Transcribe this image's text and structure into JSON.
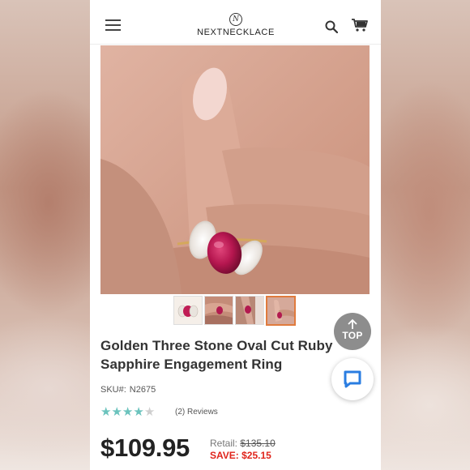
{
  "header": {
    "logo_mark": "N",
    "logo_text": "NEXTNECKLACE",
    "icons": {
      "menu": "hamburger-icon",
      "search": "search-icon",
      "cart": "cart-icon"
    }
  },
  "gallery": {
    "thumbnail_count": 4,
    "active_thumbnail": 4
  },
  "floating": {
    "top_label": "TOP",
    "chat_icon": "chat-bubble-icon"
  },
  "product": {
    "title": "Golden Three Stone Oval Cut Ruby Sapphire Engagement Ring",
    "sku_label": "SKU#:",
    "sku_value": "N2675",
    "rating": 4,
    "rating_max": 5,
    "reviews_text": "(2) Reviews",
    "price": "$109.95",
    "retail_label": "Retail:",
    "retail_value": "$135.10",
    "save_text": "SAVE: $25.15"
  },
  "colors": {
    "star_on": "#6bc3bd",
    "save_red": "#e0241b",
    "active_thumb_border": "#e07b3d"
  }
}
